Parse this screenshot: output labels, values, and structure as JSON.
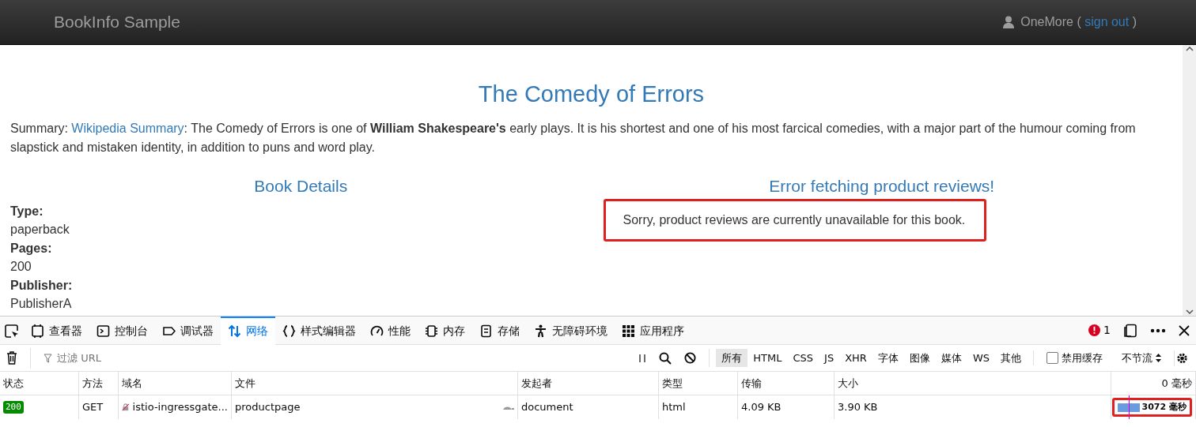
{
  "navbar": {
    "brand": "BookInfo Sample",
    "user": "OneMore",
    "open_paren": "(",
    "sign_out": "sign out",
    "close_paren": ")"
  },
  "product": {
    "title": "The Comedy of Errors",
    "summary_prefix": "Summary:",
    "summary_link": "Wikipedia Summary",
    "summary_text": ": The Comedy of Errors is one of **William Shakespeare's** early plays. It is his shortest and one of his most farcical comedies, with a major part of the humour coming from slapstick and mistaken identity, in addition to puns and word play."
  },
  "details": {
    "heading": "Book Details",
    "fields": [
      {
        "label": "Type:",
        "value": "paperback"
      },
      {
        "label": "Pages:",
        "value": "200"
      },
      {
        "label": "Publisher:",
        "value": "PublisherA"
      }
    ]
  },
  "reviews": {
    "heading": "Error fetching product reviews!",
    "message": "Sorry, product reviews are currently unavailable for this book.",
    "highlighted": true
  },
  "devtools": {
    "tools": [
      {
        "kind": "inspector",
        "label": "查看器",
        "selected": false
      },
      {
        "kind": "console",
        "label": "控制台",
        "selected": false
      },
      {
        "kind": "debugger",
        "label": "调试器",
        "selected": false
      },
      {
        "kind": "network",
        "label": "网络",
        "selected": true
      },
      {
        "kind": "style",
        "label": "样式编辑器",
        "selected": false
      },
      {
        "kind": "performance",
        "label": "性能",
        "selected": false
      },
      {
        "kind": "memory",
        "label": "内存",
        "selected": false
      },
      {
        "kind": "storage",
        "label": "存储",
        "selected": false
      },
      {
        "kind": "accessibility",
        "label": "无障碍环境",
        "selected": false
      },
      {
        "kind": "application",
        "label": "应用程序",
        "selected": false
      }
    ],
    "error_count": "1",
    "filter_placeholder": "过滤 URL",
    "type_filters": [
      {
        "label": "所有",
        "selected": true
      },
      {
        "label": "HTML",
        "selected": false
      },
      {
        "label": "CSS",
        "selected": false
      },
      {
        "label": "JS",
        "selected": false
      },
      {
        "label": "XHR",
        "selected": false
      },
      {
        "label": "字体",
        "selected": false
      },
      {
        "label": "图像",
        "selected": false
      },
      {
        "label": "媒体",
        "selected": false
      },
      {
        "label": "WS",
        "selected": false
      },
      {
        "label": "其他",
        "selected": false
      }
    ],
    "disable_cache": {
      "label": "禁用缓存",
      "checked": false
    },
    "throttle": "不节流",
    "columns": [
      "状态",
      "方法",
      "域名",
      "文件",
      "发起者",
      "类型",
      "传输",
      "大小"
    ],
    "timeline_header": "0 毫秒",
    "rows": [
      {
        "status": "200",
        "method": "GET",
        "domain": "istio-ingressgate...",
        "file": "productpage",
        "initiator": "document",
        "type": "html",
        "transferred": "4.09 KB",
        "size": "3.90 KB",
        "time": "3072 毫秒",
        "highlighted": true
      }
    ]
  }
}
